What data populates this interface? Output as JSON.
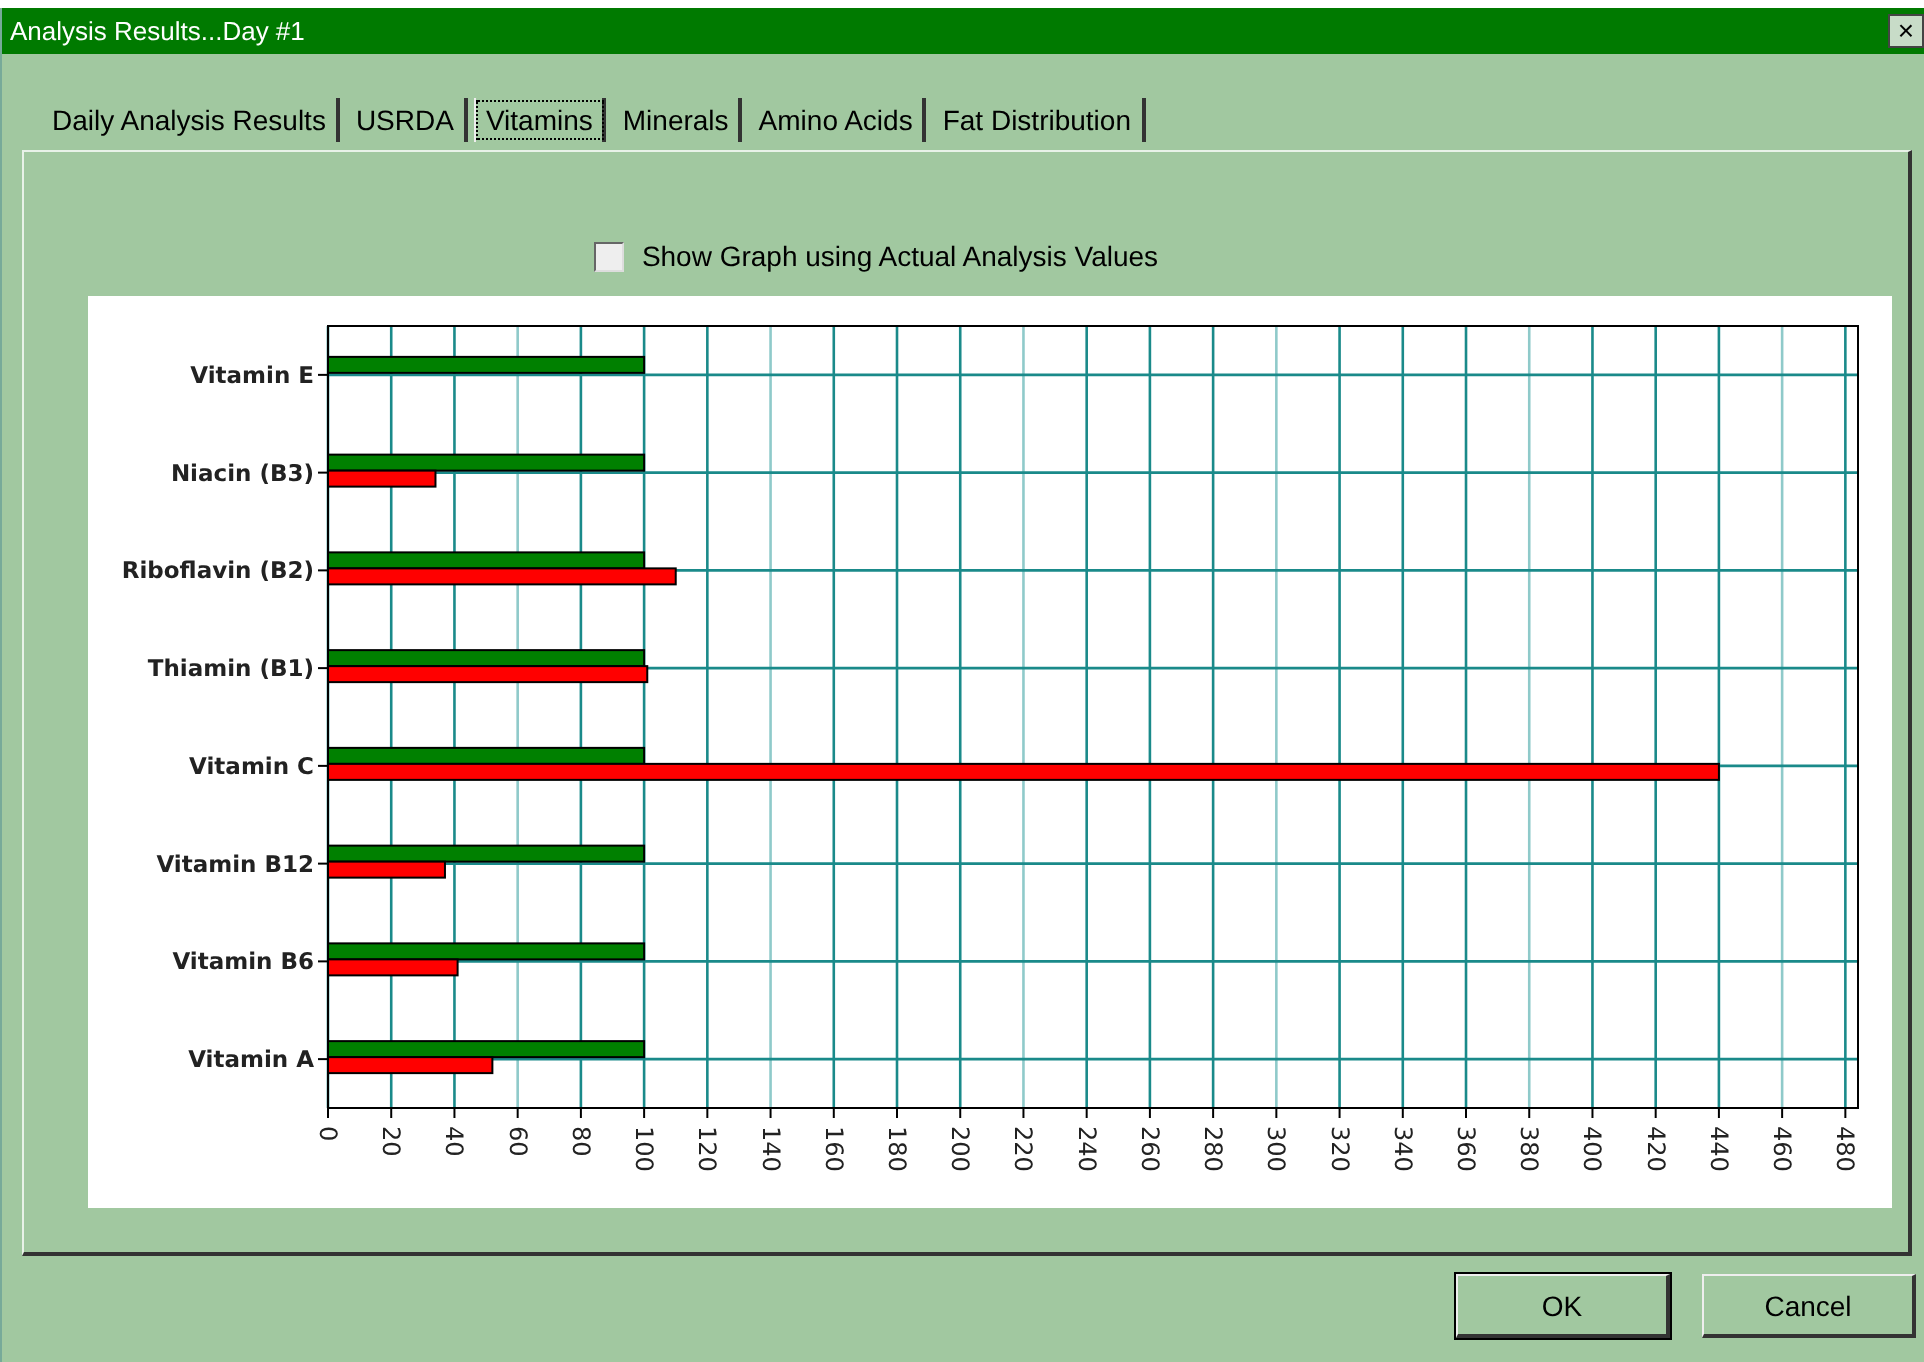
{
  "window": {
    "title": "Analysis Results...Day #1",
    "close": "×"
  },
  "tabs": [
    {
      "label": "Daily Analysis Results",
      "selected": false
    },
    {
      "label": "USRDA",
      "selected": false
    },
    {
      "label": "Vitamins",
      "selected": true
    },
    {
      "label": "Minerals",
      "selected": false
    },
    {
      "label": "Amino Acids",
      "selected": false
    },
    {
      "label": "Fat Distribution",
      "selected": false
    }
  ],
  "option": {
    "label": "Show Graph using Actual Analysis Values",
    "checked": false
  },
  "chart_data": {
    "type": "bar",
    "orientation": "horizontal",
    "grid": true,
    "categories": [
      "Vitamin E",
      "Niacin (B3)",
      "Riboflavin (B2)",
      "Thiamin (B1)",
      "Vitamin C",
      "Vitamin B12",
      "Vitamin B6",
      "Vitamin A"
    ],
    "series": [
      {
        "color": "#008000",
        "values": [
          100,
          100,
          100,
          100,
          100,
          100,
          100,
          100
        ]
      },
      {
        "color": "#ff0000",
        "values": [
          null,
          34,
          110,
          101,
          440,
          37,
          41,
          52
        ]
      }
    ],
    "xlim": [
      0,
      484
    ],
    "xticks": [
      0,
      20,
      40,
      60,
      80,
      100,
      120,
      140,
      160,
      180,
      200,
      220,
      240,
      260,
      280,
      300,
      320,
      340,
      360,
      380,
      400,
      420,
      440,
      460,
      480
    ]
  },
  "buttons": [
    {
      "label": "OK",
      "kind": "default"
    },
    {
      "label": "Cancel",
      "kind": "normal"
    }
  ]
}
